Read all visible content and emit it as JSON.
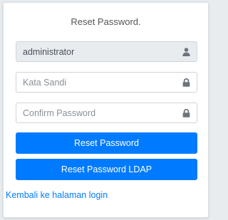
{
  "form": {
    "title": "Reset Password.",
    "username": {
      "value": "administrator",
      "icon": "user-icon"
    },
    "password": {
      "placeholder": "Kata Sandi",
      "icon": "lock-icon"
    },
    "confirm_password": {
      "placeholder": "Confirm Password",
      "icon": "lock-icon"
    },
    "reset_button_label": "Reset Password",
    "reset_ldap_button_label": "Reset Password LDAP",
    "back_link_label": "Kembali ke halaman login"
  },
  "colors": {
    "primary": "#007bff",
    "icon": "#6c757d",
    "readonly_bg": "#e9ecef"
  }
}
